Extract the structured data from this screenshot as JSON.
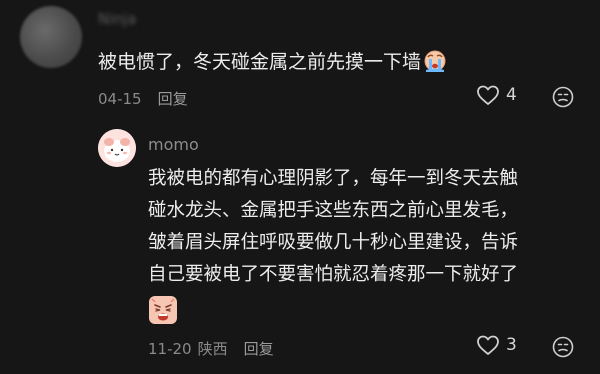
{
  "comment": {
    "username": "Ninja",
    "text": "被电惯了，冬天碰金属之前先摸一下墙",
    "date": "04-15",
    "reply_label": "回复",
    "like_count": "4"
  },
  "reply": {
    "username": "momo",
    "lines": [
      "我被电的都有心理阴影了，每年一到冬天去触",
      "碰水龙头、金属把手这些东西之前心里发毛，",
      "皱着眉头屏住呼吸要做几十秒心里建设，告诉",
      "自己要被电了不要害怕就忍着疼那一下就好了"
    ],
    "date": "11-20",
    "location": "陕西",
    "reply_label": "回复",
    "like_count": "3"
  },
  "icons": {
    "like": "heart-outline-icon",
    "dislike": "frown-face-icon",
    "crying_emoji": "crying-face-emoji",
    "pain_emoji": "pained-face-emoji"
  },
  "colors": {
    "background": "#161616",
    "text": "#ececec",
    "meta": "#8a8a8a"
  }
}
